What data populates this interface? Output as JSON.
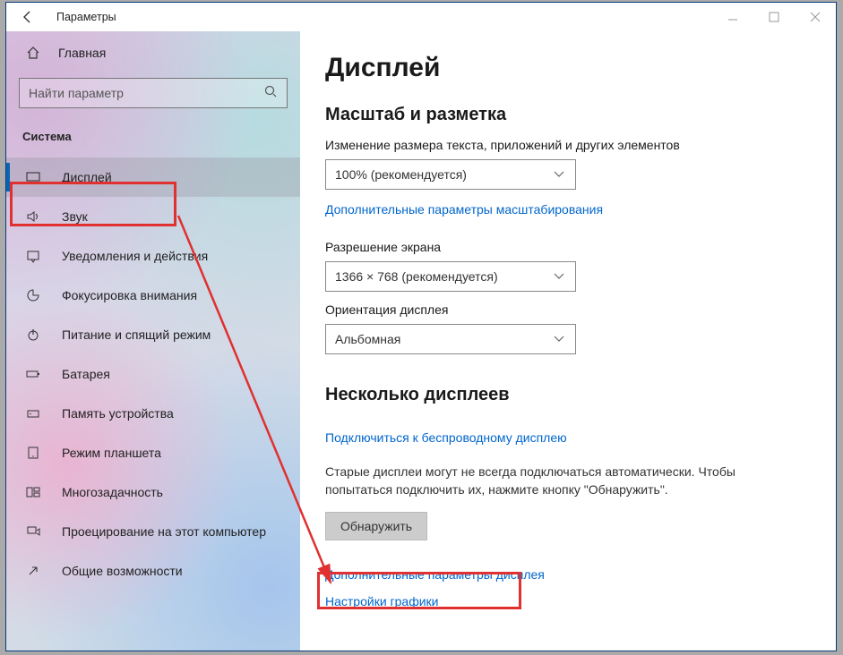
{
  "window": {
    "title": "Параметры"
  },
  "sidebar": {
    "home": "Главная",
    "search_placeholder": "Найти параметр",
    "section": "Система",
    "items": [
      {
        "label": "Дисплей"
      },
      {
        "label": "Звук"
      },
      {
        "label": "Уведомления и действия"
      },
      {
        "label": "Фокусировка внимания"
      },
      {
        "label": "Питание и спящий режим"
      },
      {
        "label": "Батарея"
      },
      {
        "label": "Память устройства"
      },
      {
        "label": "Режим планшета"
      },
      {
        "label": "Многозадачность"
      },
      {
        "label": "Проецирование на этот компьютер"
      },
      {
        "label": "Общие возможности"
      }
    ]
  },
  "main": {
    "title": "Дисплей",
    "scale_heading": "Масштаб и разметка",
    "scale_label": "Изменение размера текста, приложений и других элементов",
    "scale_value": "100% (рекомендуется)",
    "scale_advanced_link": "Дополнительные параметры масштабирования",
    "resolution_label": "Разрешение экрана",
    "resolution_value": "1366 × 768 (рекомендуется)",
    "orientation_label": "Ориентация дисплея",
    "orientation_value": "Альбомная",
    "multi_heading": "Несколько дисплеев",
    "wireless_link": "Подключиться к беспроводному дисплею",
    "detect_note": "Старые дисплеи могут не всегда подключаться автоматически. Чтобы попытаться подключить их, нажмите кнопку \"Обнаружить\".",
    "detect_btn": "Обнаружить",
    "advanced_display_link": "Дополнительные параметры дисплея",
    "graphics_link": "Настройки графики"
  }
}
